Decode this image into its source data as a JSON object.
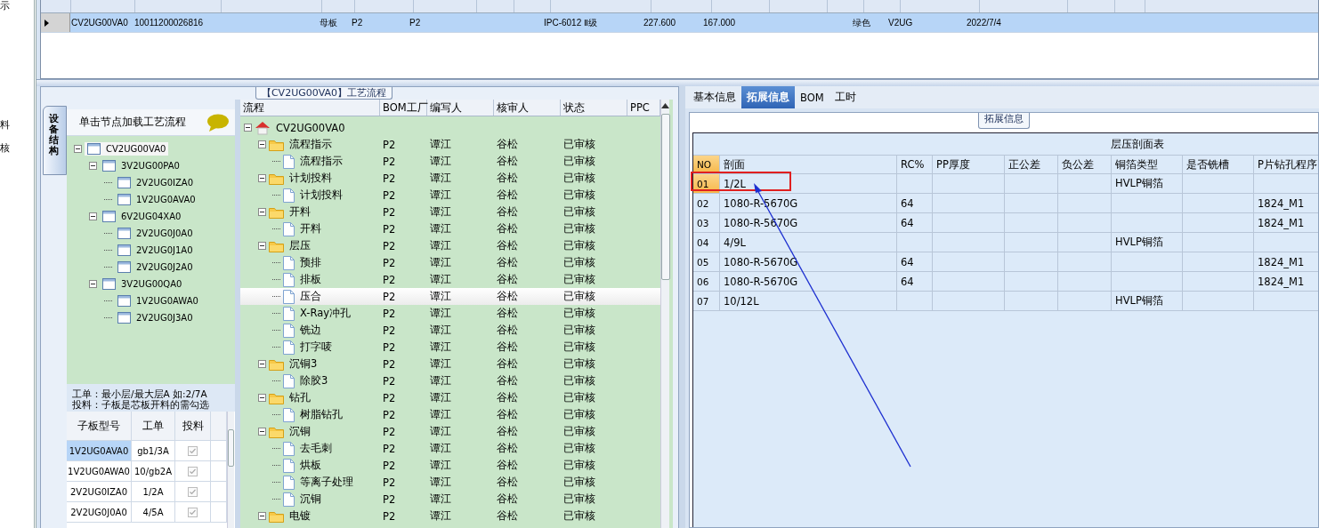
{
  "side_fragments": [
    "示",
    "料",
    "核"
  ],
  "orders_grid": {
    "rows": [
      {
        "selected": true,
        "column_1": "CV2UG00VA0",
        "column_2": "10011200026816",
        "column_4": "母板",
        "column_5": "P2",
        "column_6": "P2",
        "column_9": "IPC-6012 Ⅱ级",
        "column_10": "227.600",
        "column_11": "167.000",
        "column_14": "绿色",
        "column_15": "V2UG",
        "column_16": "2022/7/4"
      }
    ]
  },
  "process_panel": {
    "title": "【CV2UG00VA0】工艺流程",
    "side_tab": "设备结构",
    "structure": {
      "hint": "单击节点加载工艺流程",
      "tree": [
        {
          "label": "CV2UG00VA0",
          "selected": true,
          "expanded": true,
          "children": [
            {
              "label": "3V2UG00PA0",
              "selected": false,
              "expanded": true,
              "children": [
                {
                  "label": "2V2UG0IZA0",
                  "selected": false
                },
                {
                  "label": "1V2UG0AVA0",
                  "selected": false
                }
              ]
            },
            {
              "label": "6V2UG04XA0",
              "selected": false,
              "expanded": true,
              "children": [
                {
                  "label": "2V2UG0J0A0",
                  "selected": false
                },
                {
                  "label": "2V2UG0J1A0",
                  "selected": false
                },
                {
                  "label": "2V2UG0J2A0",
                  "selected": false
                }
              ]
            },
            {
              "label": "3V2UG00QA0",
              "selected": false,
              "expanded": true,
              "children": [
                {
                  "label": "1V2UG0AWA0",
                  "selected": false
                },
                {
                  "label": "2V2UG0J3A0",
                  "selected": false
                }
              ]
            }
          ]
        }
      ],
      "notes": [
        "工单：最小层/最大层A 如:2/7A",
        "投料：子板是芯板开料的需勾选"
      ],
      "subboards": {
        "columns": [
          "子板型号",
          "工单",
          "投料"
        ],
        "rows": [
          {
            "model": "1V2UG0AVA0",
            "order": "gb1/3A",
            "feed": true,
            "selected": true
          },
          {
            "model": "1V2UG0AWA0",
            "order": "10/gb2A",
            "feed": true,
            "selected": false
          },
          {
            "model": "2V2UG0IZA0",
            "order": "1/2A",
            "feed": true,
            "selected": false
          },
          {
            "model": "2V2UG0J0A0",
            "order": "4/5A",
            "feed": true,
            "selected": false
          }
        ]
      }
    },
    "flow": {
      "columns": [
        "流程",
        "BOM工厂",
        "编写人",
        "核审人",
        "状态",
        "PPC"
      ],
      "tree": [
        {
          "kind": "root",
          "label": "CV2UG00VA0",
          "selected": false,
          "expanded": true,
          "children": [
            {
              "kind": "folder",
              "label": "流程指示",
              "bom": "P2",
              "author": "谭江",
              "reviewer": "谷松",
              "status": "已审核",
              "selected": false,
              "expanded": true,
              "children": [
                {
                  "kind": "step",
                  "label": "流程指示",
                  "bom": "P2",
                  "author": "谭江",
                  "reviewer": "谷松",
                  "status": "已审核",
                  "selected": false
                }
              ]
            },
            {
              "kind": "folder",
              "label": "计划投料",
              "bom": "P2",
              "author": "谭江",
              "reviewer": "谷松",
              "status": "已审核",
              "selected": false,
              "expanded": true,
              "children": [
                {
                  "kind": "step",
                  "label": "计划投料",
                  "bom": "P2",
                  "author": "谭江",
                  "reviewer": "谷松",
                  "status": "已审核",
                  "selected": false
                }
              ]
            },
            {
              "kind": "folder",
              "label": "开料",
              "bom": "P2",
              "author": "谭江",
              "reviewer": "谷松",
              "status": "已审核",
              "selected": false,
              "expanded": true,
              "children": [
                {
                  "kind": "step",
                  "label": "开料",
                  "bom": "P2",
                  "author": "谭江",
                  "reviewer": "谷松",
                  "status": "已审核",
                  "selected": false
                }
              ]
            },
            {
              "kind": "folder",
              "label": "层压",
              "bom": "P2",
              "author": "谭江",
              "reviewer": "谷松",
              "status": "已审核",
              "selected": false,
              "expanded": true,
              "children": [
                {
                  "kind": "step",
                  "label": "预排",
                  "bom": "P2",
                  "author": "谭江",
                  "reviewer": "谷松",
                  "status": "已审核",
                  "selected": false
                },
                {
                  "kind": "step",
                  "label": "排板",
                  "bom": "P2",
                  "author": "谭江",
                  "reviewer": "谷松",
                  "status": "已审核",
                  "selected": false
                },
                {
                  "kind": "step",
                  "label": "压合",
                  "bom": "P2",
                  "author": "谭江",
                  "reviewer": "谷松",
                  "status": "已审核",
                  "selected": true
                },
                {
                  "kind": "step",
                  "label": "X-Ray冲孔",
                  "bom": "P2",
                  "author": "谭江",
                  "reviewer": "谷松",
                  "status": "已审核",
                  "selected": false
                },
                {
                  "kind": "step",
                  "label": "铣边",
                  "bom": "P2",
                  "author": "谭江",
                  "reviewer": "谷松",
                  "status": "已审核",
                  "selected": false
                },
                {
                  "kind": "step",
                  "label": "打字唛",
                  "bom": "P2",
                  "author": "谭江",
                  "reviewer": "谷松",
                  "status": "已审核",
                  "selected": false
                }
              ]
            },
            {
              "kind": "folder",
              "label": "沉铜3",
              "bom": "P2",
              "author": "谭江",
              "reviewer": "谷松",
              "status": "已审核",
              "selected": false,
              "expanded": true,
              "children": [
                {
                  "kind": "step",
                  "label": "除胶3",
                  "bom": "P2",
                  "author": "谭江",
                  "reviewer": "谷松",
                  "status": "已审核",
                  "selected": false
                }
              ]
            },
            {
              "kind": "folder",
              "label": "钻孔",
              "bom": "P2",
              "author": "谭江",
              "reviewer": "谷松",
              "status": "已审核",
              "selected": false,
              "expanded": true,
              "children": [
                {
                  "kind": "step",
                  "label": "树脂钻孔",
                  "bom": "P2",
                  "author": "谭江",
                  "reviewer": "谷松",
                  "status": "已审核",
                  "selected": false
                }
              ]
            },
            {
              "kind": "folder",
              "label": "沉铜",
              "bom": "P2",
              "author": "谭江",
              "reviewer": "谷松",
              "status": "已审核",
              "selected": false,
              "expanded": true,
              "children": [
                {
                  "kind": "step",
                  "label": "去毛刺",
                  "bom": "P2",
                  "author": "谭江",
                  "reviewer": "谷松",
                  "status": "已审核",
                  "selected": false
                },
                {
                  "kind": "step",
                  "label": "烘板",
                  "bom": "P2",
                  "author": "谭江",
                  "reviewer": "谷松",
                  "status": "已审核",
                  "selected": false
                },
                {
                  "kind": "step",
                  "label": "等离子处理",
                  "bom": "P2",
                  "author": "谭江",
                  "reviewer": "谷松",
                  "status": "已审核",
                  "selected": false
                },
                {
                  "kind": "step",
                  "label": "沉铜",
                  "bom": "P2",
                  "author": "谭江",
                  "reviewer": "谷松",
                  "status": "已审核",
                  "selected": false
                }
              ]
            },
            {
              "kind": "folder",
              "label": "电镀",
              "bom": "P2",
              "author": "谭江",
              "reviewer": "谷松",
              "status": "已审核",
              "selected": false,
              "expanded": true
            }
          ]
        }
      ]
    }
  },
  "detail_panel": {
    "tabs": [
      {
        "label": "基本信息",
        "selected": false
      },
      {
        "label": "拓展信息",
        "selected": true
      },
      {
        "label": "BOM",
        "selected": false
      },
      {
        "label": "工时",
        "selected": false
      }
    ],
    "group_title": "拓展信息",
    "layup_table": {
      "title": "层压剖面表",
      "columns": [
        "NO",
        "剖面",
        "RC%",
        "PP厚度",
        "正公差",
        "负公差",
        "铜箔类型",
        "是否铣槽",
        "P片钻孔程序"
      ],
      "rows": [
        {
          "selected": true,
          "no": "01",
          "section": "1/2L",
          "foil": "HVLP铜箔"
        },
        {
          "selected": false,
          "no": "02",
          "section": "1080-R-5670G",
          "rc": "64",
          "drill": "1824_M1"
        },
        {
          "selected": false,
          "no": "03",
          "section": "1080-R-5670G",
          "rc": "64",
          "drill": "1824_M1"
        },
        {
          "selected": false,
          "no": "04",
          "section": "4/9L",
          "foil": "HVLP铜箔"
        },
        {
          "selected": false,
          "no": "05",
          "section": "1080-R-5670G",
          "rc": "64",
          "drill": "1824_M1"
        },
        {
          "selected": false,
          "no": "06",
          "section": "1080-R-5670G",
          "rc": "64",
          "drill": "1824_M1"
        },
        {
          "selected": false,
          "no": "07",
          "section": "10/12L",
          "foil": "HVLP铜箔"
        }
      ]
    }
  }
}
